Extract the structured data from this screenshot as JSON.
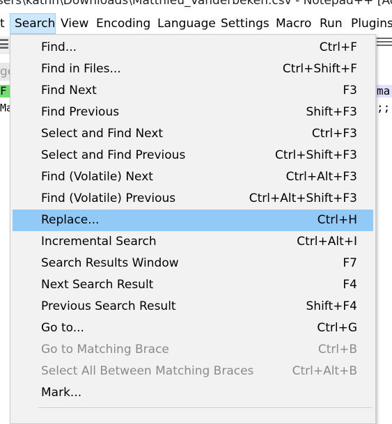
{
  "window": {
    "title": "sers\\kathh\\Downloads\\Matthieu_Vanderbeken.csv - Notepad++ [Admi"
  },
  "menubar": {
    "items": [
      {
        "label": "t"
      },
      {
        "label": "Search",
        "active": true
      },
      {
        "label": "View"
      },
      {
        "label": "Encoding"
      },
      {
        "label": "Language"
      },
      {
        "label": "Settings"
      },
      {
        "label": "Macro"
      },
      {
        "label": "Run"
      },
      {
        "label": "Plugins"
      }
    ]
  },
  "editor": {
    "tab_fragment": "ge",
    "line1_fragment": "F",
    "line2_fragment": "Ma",
    "line1_right_fragment": "ma",
    "line2_right_fragment": ";;"
  },
  "search_menu": {
    "items": [
      {
        "label": "Find...",
        "shortcut": "Ctrl+F"
      },
      {
        "label": "Find in Files...",
        "shortcut": "Ctrl+Shift+F"
      },
      {
        "label": "Find Next",
        "shortcut": "F3"
      },
      {
        "label": "Find Previous",
        "shortcut": "Shift+F3"
      },
      {
        "label": "Select and Find Next",
        "shortcut": "Ctrl+F3"
      },
      {
        "label": "Select and Find Previous",
        "shortcut": "Ctrl+Shift+F3"
      },
      {
        "label": "Find (Volatile) Next",
        "shortcut": "Ctrl+Alt+F3"
      },
      {
        "label": "Find (Volatile) Previous",
        "shortcut": "Ctrl+Alt+Shift+F3"
      },
      {
        "label": "Replace...",
        "shortcut": "Ctrl+H",
        "highlighted": true
      },
      {
        "label": "Incremental Search",
        "shortcut": "Ctrl+Alt+I"
      },
      {
        "label": "Search Results Window",
        "shortcut": "F7"
      },
      {
        "label": "Next Search Result",
        "shortcut": "F4"
      },
      {
        "label": "Previous Search Result",
        "shortcut": "Shift+F4"
      },
      {
        "label": "Go to...",
        "shortcut": "Ctrl+G"
      },
      {
        "label": "Go to Matching Brace",
        "shortcut": "Ctrl+B",
        "disabled": true
      },
      {
        "label": "Select All Between Matching Braces",
        "shortcut": "Ctrl+Alt+B",
        "disabled": true
      },
      {
        "label": "Mark...",
        "shortcut": ""
      }
    ]
  },
  "colors": {
    "menu_background": "#f2f2f2",
    "highlight": "#91c9f7",
    "menubar_active": "#cce8ff",
    "disabled_text": "#8a8a8a"
  }
}
